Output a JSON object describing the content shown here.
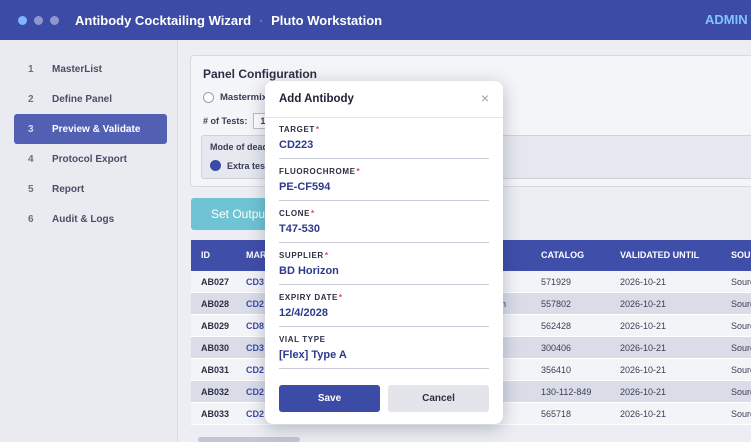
{
  "window": {
    "title": "Antibody Cocktailing Wizard",
    "separator": "·",
    "workstation": "Pluto Workstation",
    "user": "ADMIN"
  },
  "sidebar": {
    "items": [
      {
        "num": "1",
        "label": "MasterList"
      },
      {
        "num": "2",
        "label": "Define Panel"
      },
      {
        "num": "3",
        "label": "Preview & Validate"
      },
      {
        "num": "4",
        "label": "Protocol Export"
      },
      {
        "num": "5",
        "label": "Report"
      },
      {
        "num": "6",
        "label": "Audit & Logs"
      }
    ],
    "active_index": 2
  },
  "panel": {
    "title": "Panel Configuration",
    "mastermix_label": "Mastermix",
    "tests_label": "# of Tests:",
    "tests_value": "1",
    "mode_label": "Mode of dead",
    "mode_option": "Extra test"
  },
  "set_output_label": "Set Outpu",
  "table": {
    "headers": [
      "ID",
      "MAR",
      "CATALOG",
      "VALIDATED UNTIL",
      "SOUR"
    ],
    "rows": [
      {
        "id": "AB027",
        "mar": "CD3",
        "part": "n",
        "catalog": "571929",
        "validated": "2026-10-21",
        "source": "Sourc"
      },
      {
        "id": "AB028",
        "mar": "CD2",
        "part": "ngen",
        "catalog": "557802",
        "validated": "2026-10-21",
        "source": "Sourc"
      },
      {
        "id": "AB029",
        "mar": "CD8",
        "part": "n",
        "catalog": "562428",
        "validated": "2026-10-21",
        "source": "Sourc"
      },
      {
        "id": "AB030",
        "mar": "CD3",
        "part": "",
        "catalog": "300406",
        "validated": "2026-10-21",
        "source": "Sourc"
      },
      {
        "id": "AB031",
        "mar": "CD2",
        "part": "",
        "catalog": "356410",
        "validated": "2026-10-21",
        "source": "Sourc"
      },
      {
        "id": "AB032",
        "mar": "CD2",
        "part": "otec",
        "catalog": "130-112-849",
        "validated": "2026-10-21",
        "source": "Sourc"
      },
      {
        "id": "AB033",
        "mar": "CD2",
        "part": "n",
        "catalog": "565718",
        "validated": "2026-10-21",
        "source": "Sourc"
      }
    ]
  },
  "modal": {
    "title": "Add Antibody",
    "close_glyph": "×",
    "fields": [
      {
        "label": "TARGET",
        "required": true,
        "value": "CD223"
      },
      {
        "label": "FLUOROCHROME",
        "required": true,
        "value": "PE-CF594"
      },
      {
        "label": "CLONE",
        "required": true,
        "value": "T47-530"
      },
      {
        "label": "SUPPLIER",
        "required": true,
        "value": "BD Horizon"
      },
      {
        "label": "EXPIRY DATE",
        "required": true,
        "value": "12/4/2028"
      },
      {
        "label": "VIAL TYPE",
        "required": false,
        "value": "[Flex] Type A"
      }
    ],
    "required_mark": "*",
    "save_label": "Save",
    "cancel_label": "Cancel"
  },
  "colors": {
    "accent": "#3b4ba6",
    "active_nav": "#5260b3",
    "teal_button": "#6fc4d3",
    "required": "#e0407a"
  }
}
